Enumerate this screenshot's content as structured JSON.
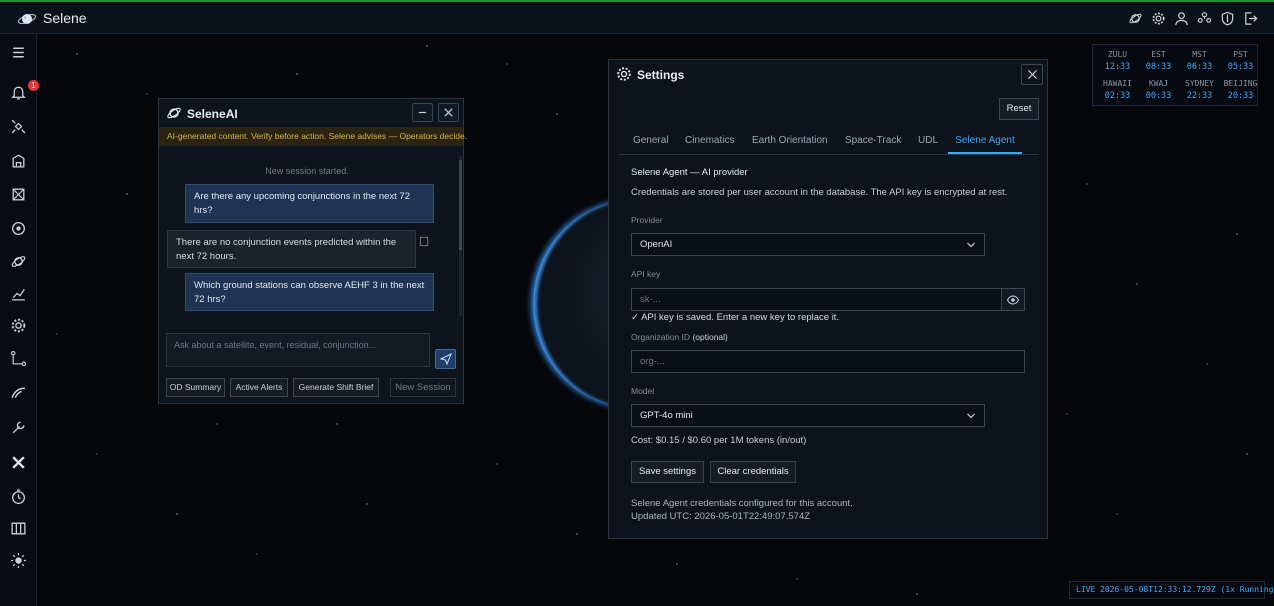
{
  "app": {
    "title": "Selene"
  },
  "topbar": {
    "icons": [
      "planet-icon",
      "gear-icon",
      "user-icon",
      "users-icon",
      "shield-icon",
      "logout-icon"
    ]
  },
  "sidebar": {
    "alert_count": "1",
    "icons": [
      "menu-icon",
      "bell-icon",
      "satellite-icon",
      "building-icon",
      "radar-icon",
      "target-icon",
      "orbit-icon",
      "chart-icon",
      "settings-wheel-icon",
      "graph-icon",
      "curve-icon",
      "wrench-icon",
      "tools-icon",
      "clock-icon",
      "map-icon",
      "sun-icon"
    ]
  },
  "clocks": [
    {
      "zone": "ZULU",
      "time": "12:33"
    },
    {
      "zone": "EST",
      "time": "08:33"
    },
    {
      "zone": "MST",
      "time": "06:33"
    },
    {
      "zone": "PST",
      "time": "05:33"
    },
    {
      "zone": "HAWAII",
      "time": "02:33"
    },
    {
      "zone": "KWAJ",
      "time": "00:33"
    },
    {
      "zone": "SYDNEY",
      "time": "22:33"
    },
    {
      "zone": "BEIJING",
      "time": "20:33"
    }
  ],
  "live_status": "LIVE 2026-05-08T12:33:12.729Z (1x Running)",
  "selene_ai": {
    "title": "SeleneAI",
    "warning": "AI-generated content. Verify before action. Selene advises — Operators decide.",
    "session_started": "New session started.",
    "messages": [
      {
        "role": "user",
        "text": "Are there any upcoming conjunctions in the next 72 hrs?"
      },
      {
        "role": "assistant",
        "text": "There are no conjunction events predicted within the next 72 hours."
      },
      {
        "role": "user",
        "text": "Which ground stations can observe AEHF 3 in the next 72 hrs?"
      }
    ],
    "input_placeholder": "Ask about a satellite, event, residual, conjunction...",
    "quick_buttons": [
      "OD Summary",
      "Active Alerts",
      "Generate Shift Brief"
    ],
    "new_session": "New Session"
  },
  "settings": {
    "title": "Settings",
    "reset": "Reset",
    "tabs": [
      "General",
      "Cinematics",
      "Earth Orientation",
      "Space-Track",
      "UDL",
      "Selene Agent"
    ],
    "active_tab": "Selene Agent",
    "section_title": "Selene Agent — AI provider",
    "description": "Credentials are stored per user account in the database. The API key is encrypted at rest.",
    "provider_label": "Provider",
    "provider_value": "OpenAI",
    "api_key_label": "API key",
    "api_key_placeholder": "sk-...",
    "api_key_saved": "✓ API key is saved. Enter a new key to replace it.",
    "org_label": "Organization ID",
    "org_optional": "(optional)",
    "org_placeholder": "org-...",
    "model_label": "Model",
    "model_value": "GPT-4o mini",
    "cost": "Cost: $0.15 / $0.60 per 1M tokens (in/out)",
    "save_button": "Save settings",
    "clear_button": "Clear credentials",
    "status_line1": "Selene Agent credentials configured for this account.",
    "status_line2": "Updated UTC: 2026-05-01T22:49:07.574Z"
  },
  "colors": {
    "accent": "#3fa9ff",
    "warning": "#d8b44a",
    "badge": "#e2383f",
    "topbar_border": "#1e8a3a"
  }
}
